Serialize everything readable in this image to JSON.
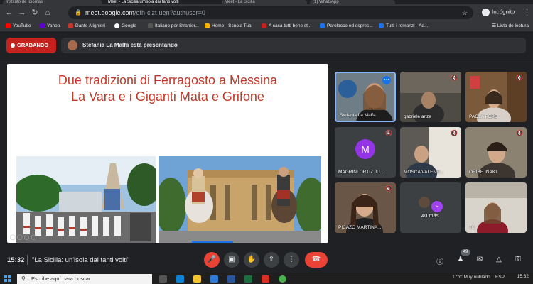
{
  "browser": {
    "tabs": [
      {
        "label": "Instituto de Idiomas"
      },
      {
        "label": "Meet - La Sicilia un'isola dai tanti volti"
      },
      {
        "label": "Meet - La Sicilia"
      },
      {
        "label": "(1) WhatsApp"
      }
    ],
    "url_host": "meet.google.com",
    "url_path": "/ofh-cjzt-uen?authuser=0",
    "profile_label": "Incógnito",
    "bookmarks": [
      {
        "label": "YouTube",
        "color": "#ff0000"
      },
      {
        "label": "Yahoo",
        "color": "#6001d2"
      },
      {
        "label": "Dante Alighieri",
        "color": "#c0392b"
      },
      {
        "label": "Google",
        "color": "#ffffff"
      },
      {
        "label": "Italiano per Stranier...",
        "color": "#555555"
      },
      {
        "label": "Home - Scuola Tua",
        "color": "#f4b400"
      },
      {
        "label": "A casa tutti bene st...",
        "color": "#c5221f"
      },
      {
        "label": "Parolacce ed espres...",
        "color": "#1a73e8"
      },
      {
        "label": "Tutti i romanzi - Ad...",
        "color": "#1a73e8"
      }
    ],
    "reading_list": "Lista de lectura"
  },
  "meet": {
    "recording_label": "GRABANDO",
    "presenter_text": "Stefania La Malfa está presentando",
    "slide": {
      "title_line1": "Due tradizioni di Ferragosto a Messina",
      "title_line2": "La Vara e i Giganti Mata e Grifone"
    },
    "participants": [
      {
        "name": "Stefania La Malfa",
        "active": true
      },
      {
        "name": "gabriele anza"
      },
      {
        "name": "PAOLA PEPE"
      },
      {
        "name": "MAGRINI ORTIZ JU...",
        "initial": "M"
      },
      {
        "name": "MOSCA VALENTI..."
      },
      {
        "name": "ORIBE IÑAKI"
      },
      {
        "name": "PICAZO MARTINA..."
      },
      {
        "name": "40 más",
        "extra_initial": "F"
      },
      {
        "name": "Tú"
      }
    ],
    "bottom": {
      "time": "15:32",
      "meeting_name": "\"La Sicilia: un'isola dai tanti volti\"",
      "participant_count": "49"
    }
  },
  "taskbar": {
    "search_placeholder": "Escribe aquí para buscar",
    "weather": "17°C  Muy nublado",
    "language": "ESP",
    "clock_time": "15:32"
  }
}
